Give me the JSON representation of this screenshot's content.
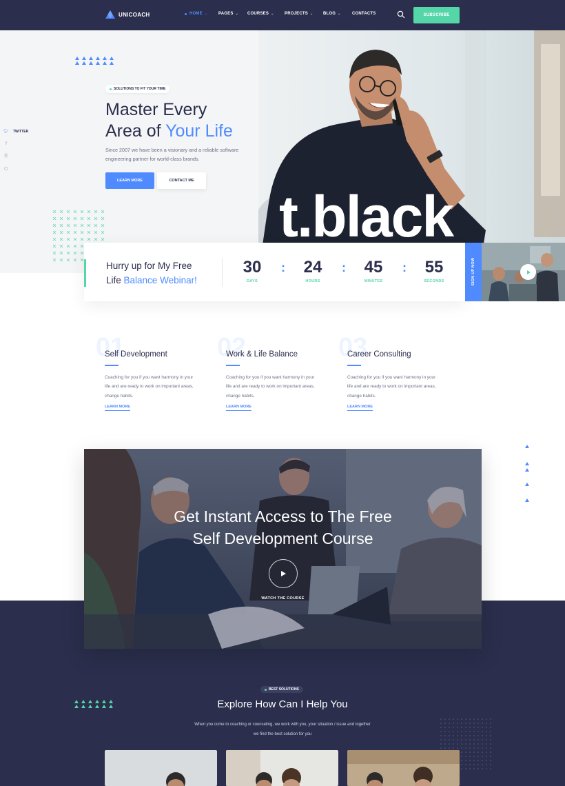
{
  "nav": {
    "logo": "UNICOACH",
    "items": [
      {
        "label": "HOME",
        "active": true,
        "dropdown": true
      },
      {
        "label": "PAGES",
        "active": false,
        "dropdown": true
      },
      {
        "label": "COURSES",
        "active": false,
        "dropdown": true
      },
      {
        "label": "PROJECTS",
        "active": false,
        "dropdown": true
      },
      {
        "label": "BLOG",
        "active": false,
        "dropdown": true
      },
      {
        "label": "CONTACTS",
        "active": false,
        "dropdown": false
      }
    ],
    "subscribe": "SUBSCRIBE",
    "search_icon": "search-icon"
  },
  "social": {
    "twitter": "TWITTER",
    "icons": [
      "twitter-icon",
      "facebook-icon",
      "pinterest-icon",
      "instagram-icon"
    ]
  },
  "hero": {
    "pill": "SOLUTIONS TO FIT YOUR TIME",
    "title_line1": "Master Every",
    "title_line2a": "Area of ",
    "title_line2b": "Your Life",
    "description": "Since 2007 we have been a visionary and a reliable software engineering partner for world-class brands.",
    "btn_learn": "LEARN MORE",
    "btn_contact": "CONTACT ME",
    "brand_text": "t.black"
  },
  "webinar": {
    "line1": "Hurry up for My Free",
    "line2a": "Life ",
    "line2b": "Balance Webinar!",
    "countdown": [
      {
        "num": "30",
        "label": "DAYS"
      },
      {
        "num": "24",
        "label": "HOURS"
      },
      {
        "num": "45",
        "label": "MINUTES"
      },
      {
        "num": "55",
        "label": "SECONDS"
      }
    ],
    "signup": "SIGN UP NOW"
  },
  "services": [
    {
      "num": "01",
      "title": "Self Development",
      "desc": "Coaching for you if you want harmony in your life and are ready to work on important areas, change habits.",
      "link": "LEARN MORE"
    },
    {
      "num": "02",
      "title": "Work & Life Balance",
      "desc": "Coaching for you if you want harmony in your life and are ready to work on important areas, change habits.",
      "link": "LEARN MORE"
    },
    {
      "num": "03",
      "title": "Career Consulting",
      "desc": "Coaching for you if you want harmony in your life and are ready to work on important areas, change habits.",
      "link": "LEARN MORE"
    }
  ],
  "video": {
    "title_line1": "Get Instant Access to The Free",
    "title_line2": "Self Development Course",
    "caption": "WATCH THE COURSE"
  },
  "solutions": {
    "pill": "BEST SOLUTIONS",
    "title": "Explore How Can I Help You",
    "desc": "When you come to coaching or counseling, we work with you, your situation / issue and together we find the best solution for you"
  },
  "colors": {
    "navy": "#2b2e4c",
    "blue": "#4f8bff",
    "green": "#55d6a9"
  }
}
